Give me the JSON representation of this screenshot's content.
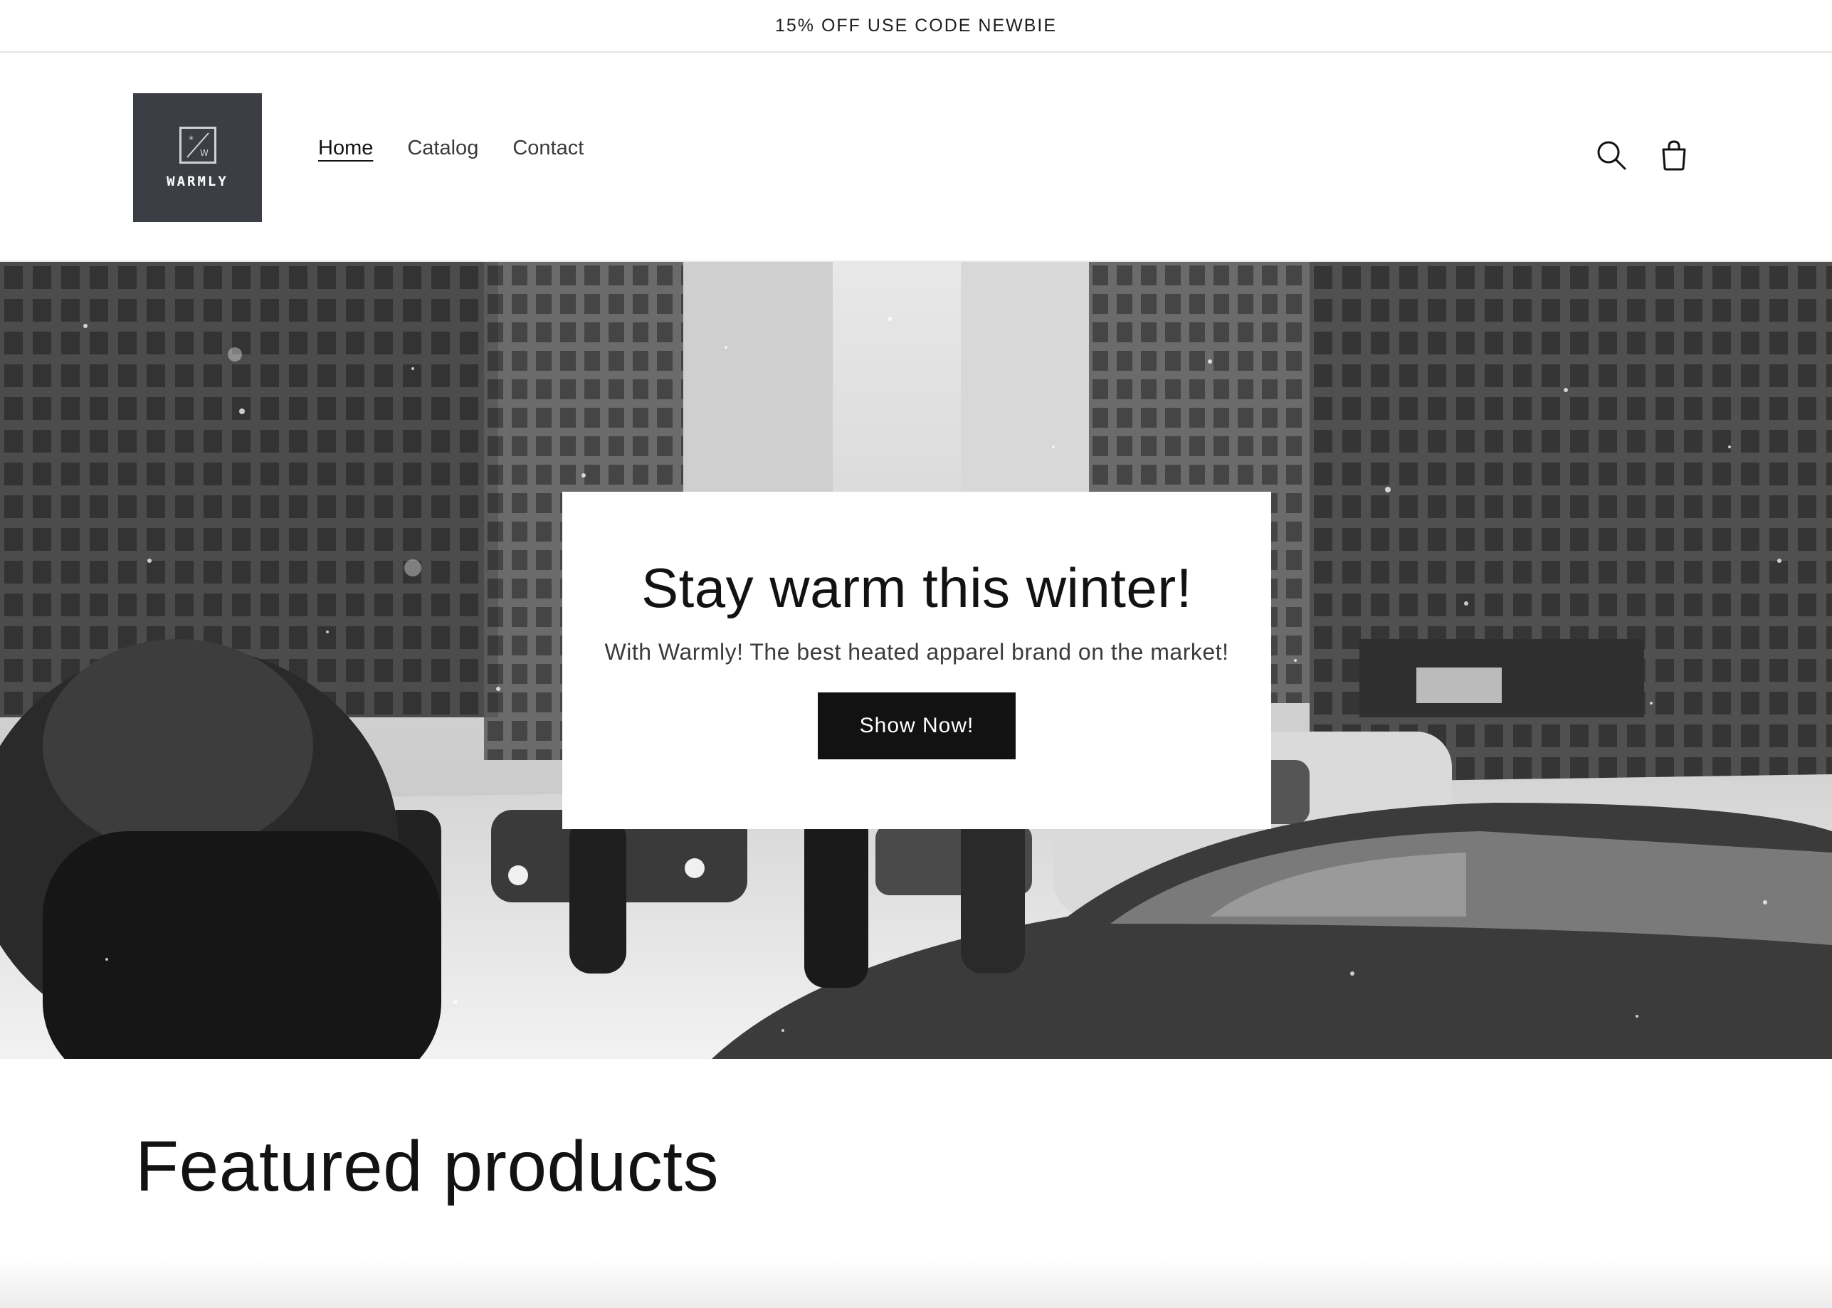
{
  "announcement": {
    "text": "15% OFF USE CODE NEWBIE"
  },
  "header": {
    "logo": {
      "text": "WARMLY",
      "icon": "snowflake-w-mark"
    },
    "nav": [
      {
        "label": "Home",
        "active": true
      },
      {
        "label": "Catalog",
        "active": false
      },
      {
        "label": "Contact",
        "active": false
      }
    ],
    "icons": [
      "search-icon",
      "cart-icon"
    ]
  },
  "hero": {
    "image": "snowy-city-street-photo",
    "title": "Stay warm this winter!",
    "subtitle": "With Warmly! The best heated apparel brand on the market!",
    "button_label": "Show Now!"
  },
  "featured": {
    "heading": "Featured products"
  },
  "colors": {
    "logo_bg": "#3b3f45",
    "button_bg": "#121212",
    "text": "#121212"
  }
}
